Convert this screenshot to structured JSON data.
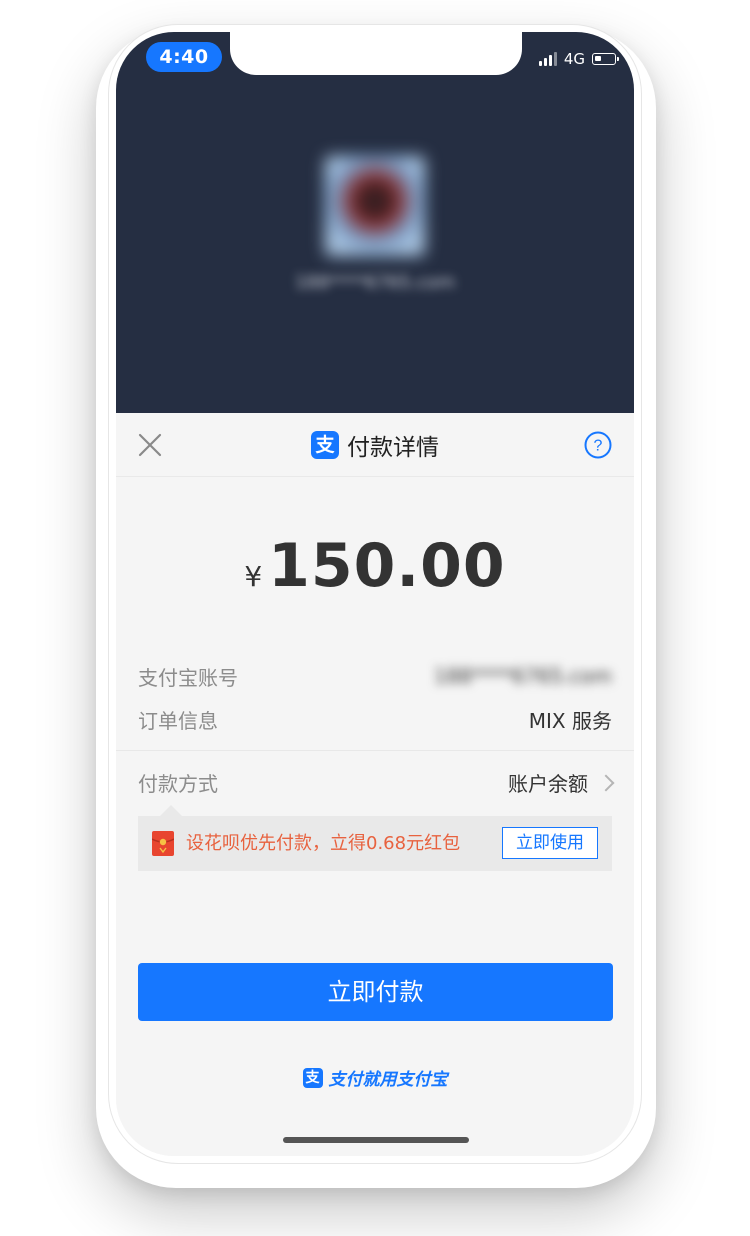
{
  "status_bar": {
    "time": "4:40",
    "network": "4G",
    "battery_level": 0.35
  },
  "merchant": {
    "name_blurred": "188****6765.com"
  },
  "sheet": {
    "title": "付款详情",
    "logo_glyph": "支"
  },
  "payment": {
    "currency_symbol": "¥",
    "amount": "150.00",
    "account_label": "支付宝账号",
    "account_value_blurred": "188****6765.com",
    "order_label": "订单信息",
    "order_value": "MIX 服务",
    "method_label": "付款方式",
    "method_value": "账户余额"
  },
  "promo": {
    "text": "设花呗优先付款，立得0.68元红包",
    "button_label": "立即使用"
  },
  "actions": {
    "pay_button_label": "立即付款"
  },
  "footer": {
    "logo_glyph": "支",
    "slogan": "支付就用支付宝"
  },
  "colors": {
    "brand_blue": "#1677ff",
    "header_dark": "#252e42",
    "promo_red": "#e8623f",
    "sheet_bg": "#f5f5f5"
  },
  "icons": {
    "close": "close-icon",
    "help": "help-icon",
    "chevron": "chevron-right-icon",
    "red_packet": "red-packet-icon"
  }
}
